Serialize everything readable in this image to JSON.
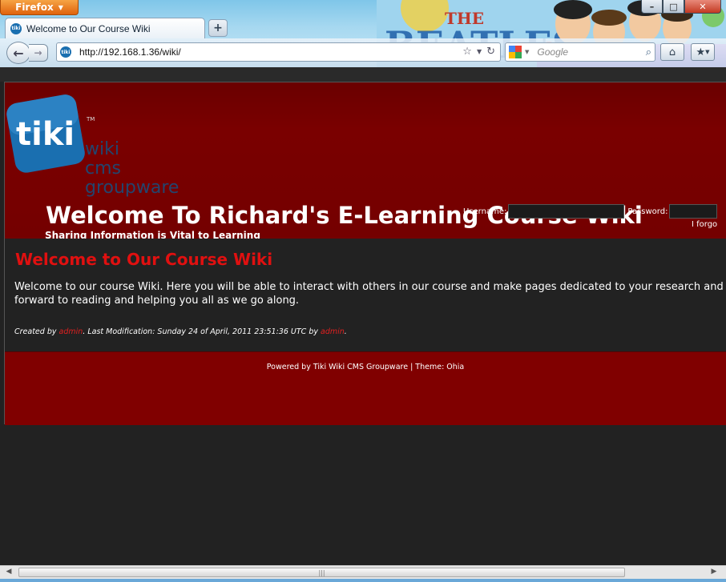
{
  "browser": {
    "menu_button": "Firefox",
    "window_controls": [
      "–",
      "□",
      "✕"
    ],
    "tab_title": "Welcome to Our Course Wiki",
    "new_tab_label": "+",
    "url": "http://192.168.1.36/wiki/",
    "search_placeholder": "Google",
    "favicon_text": "tiki",
    "scroll_grip": "|||"
  },
  "site": {
    "logo": {
      "mark": "tiki",
      "tm": "TM",
      "tagline_lines": [
        "wiki",
        "cms",
        "groupware"
      ]
    },
    "title": "Welcome To Richard's E-Learning Course Wiki",
    "slogan": "Sharing Information is Vital to Learning",
    "login": {
      "username_label": "Username:",
      "password_label": "Password:",
      "forgot_text": "I forgo"
    }
  },
  "page": {
    "heading": "Welcome to Our Course Wiki",
    "body_line1": "Welcome to our course Wiki. Here you will be able to interact with others in our course and make pages dedicated to your research and wor",
    "body_line2": "forward to reading and helping you all as we go along.",
    "meta": {
      "created_by_label": "Created by",
      "creator": "admin",
      "modification_text": ". Last Modification: Sunday 24 of April, 2011 23:51:36 UTC by",
      "modifier": "admin",
      "end": "."
    }
  },
  "footer": {
    "text": "Powered by Tiki Wiki CMS Groupware | Theme: Ohia"
  },
  "colors": {
    "header_red": "#7a0000",
    "footer_red": "#800000",
    "heading_red": "#e01010",
    "page_bg": "#222222",
    "logo_blue": "#1a6fb0",
    "tagline_navy": "#23456e",
    "firefox_orange": "#e0620c"
  }
}
